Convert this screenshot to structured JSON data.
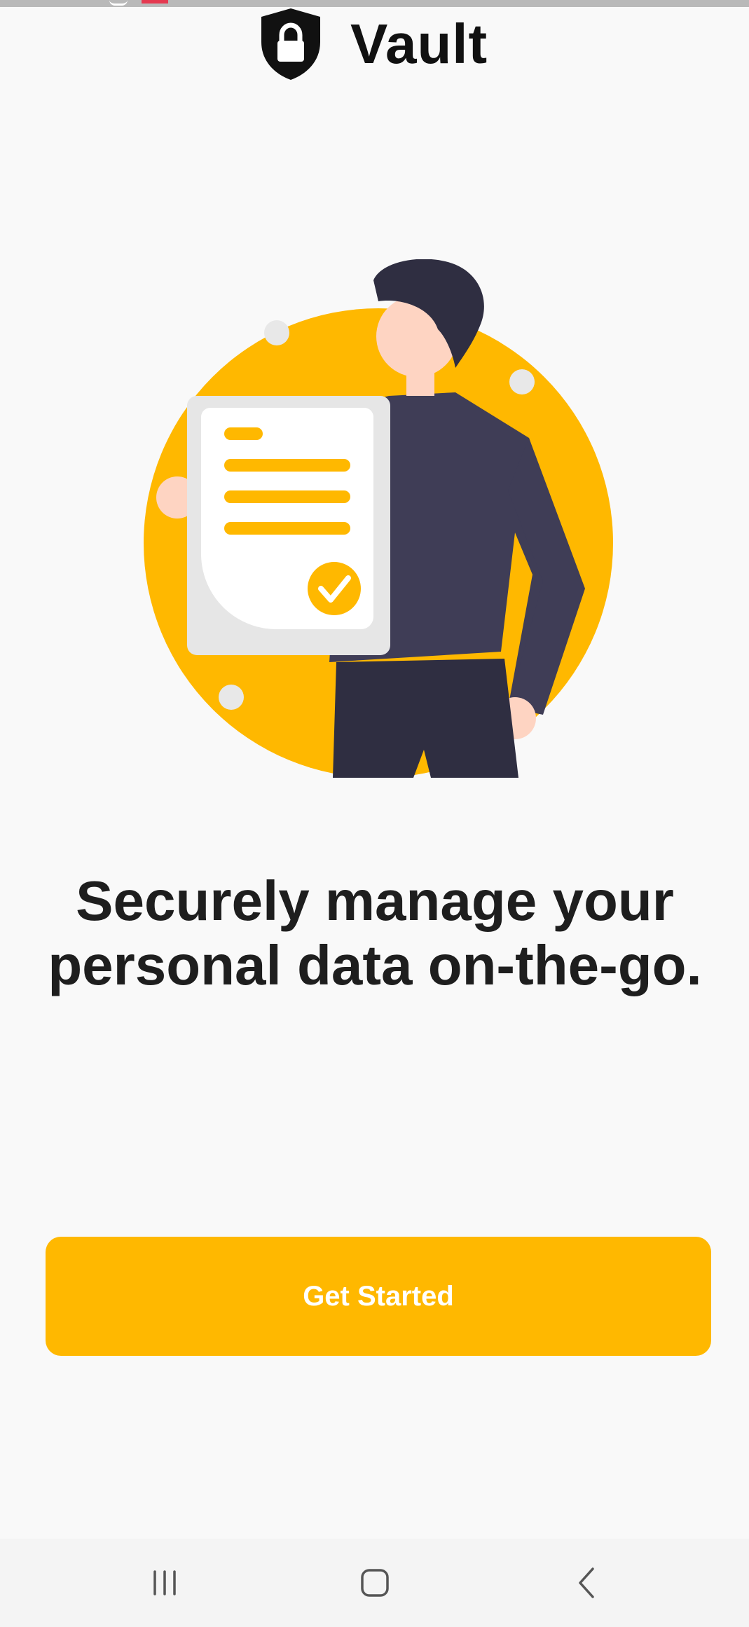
{
  "app": {
    "brand_name": "Vault",
    "brand_color": "#ffb800"
  },
  "onboarding": {
    "headline": "Securely manage your\npersonal data on-the-go.",
    "cta_label": "Get Started"
  },
  "icons": {
    "logo": "shield-lock-icon",
    "illustration": "person-holding-document-illustration",
    "nav_recent": "recent-apps-icon",
    "nav_home": "home-icon",
    "nav_back": "back-icon"
  }
}
